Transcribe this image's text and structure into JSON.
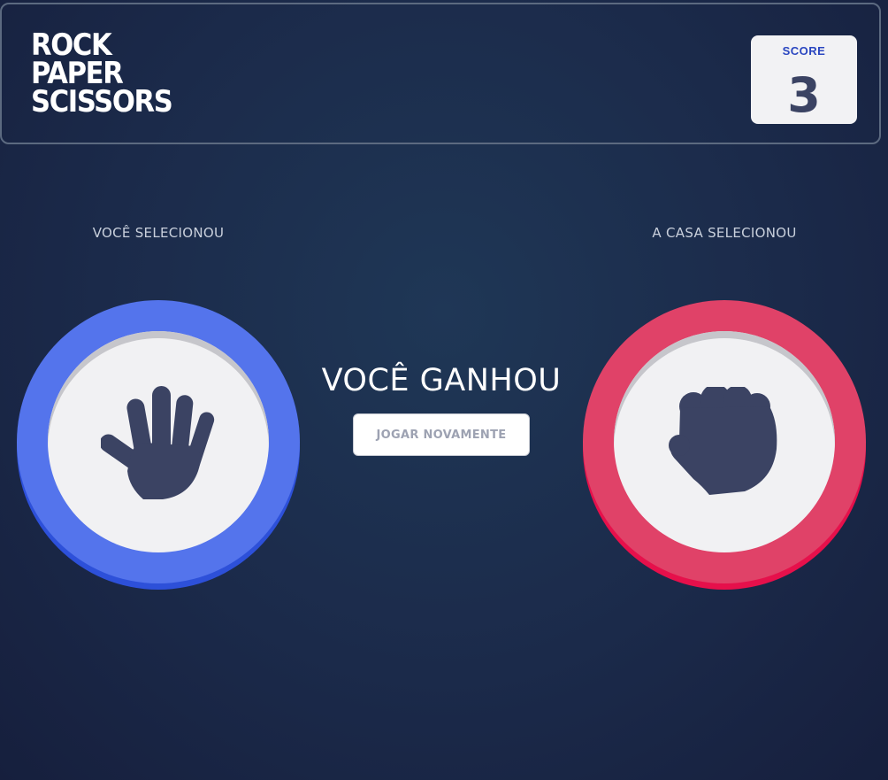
{
  "header": {
    "title_lines": [
      "ROCK",
      "PAPER",
      "SCISSORS"
    ],
    "score_label": "SCORE",
    "score_value": "3"
  },
  "player": {
    "label": "VOCÊ SELECIONOU",
    "pick": "paper",
    "icon": "hand-paper-icon",
    "ring_color": "#5474ec"
  },
  "house": {
    "label": "A CASA SELECIONOU",
    "pick": "rock",
    "icon": "hand-rock-icon",
    "ring_color": "#e04268"
  },
  "result": {
    "text": "VOCÊ GANHOU",
    "play_again_label": "JOGAR NOVAMENTE"
  }
}
